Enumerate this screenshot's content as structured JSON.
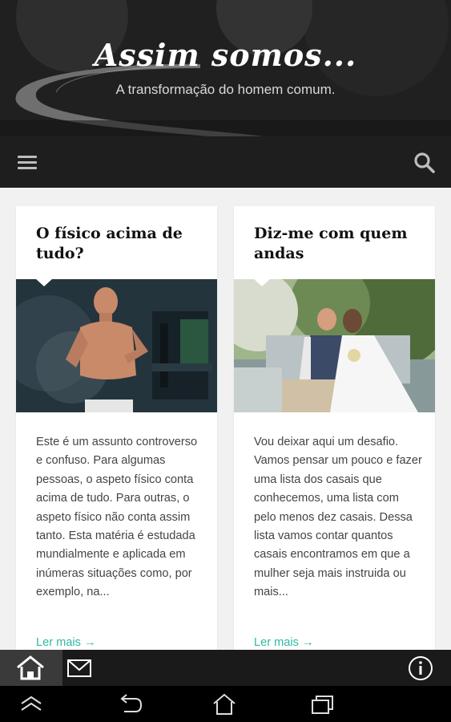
{
  "header": {
    "title": "Assim somos...",
    "subtitle": "A transformação do homem comum."
  },
  "navbar": {
    "menu_icon": "hamburger-menu-icon",
    "search_icon": "search-icon"
  },
  "posts": [
    {
      "title": "O físico acima de tudo?",
      "excerpt": "Este é um assunto controverso e confuso. Para algumas pessoas, o aspeto físico conta acima de tudo. Para outras, o aspeto físico não conta assim tanto. Esta matéria é estudada mundialmente e aplicada em inúmeras situações como, por exemplo, na...",
      "read_more": "Ler mais →"
    },
    {
      "title": "Diz-me com quem andas",
      "excerpt": "Vou deixar aqui um desafio. Vamos pensar um pouco e fazer uma lista dos casais que conhecemos, uma lista com pelo menos dez casais. Dessa lista vamos contar quantos casais encontramos em que a mulher seja mais instruida ou mais...",
      "read_more": "Ler mais →"
    }
  ],
  "bottom_bar": {
    "icons": [
      "home-icon",
      "mail-icon",
      "info-icon"
    ]
  },
  "system_nav": {
    "icons": [
      "chevron-up-icon",
      "back-icon",
      "home-icon",
      "recent-apps-icon"
    ]
  },
  "colors": {
    "accent": "#2fb8a4",
    "navbar": "#1e1e1e",
    "page_bg": "#f1f1f1"
  }
}
